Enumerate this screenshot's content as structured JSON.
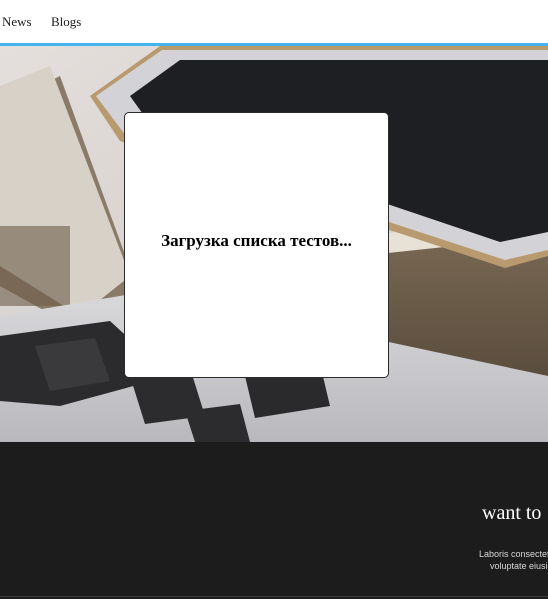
{
  "nav": {
    "items": [
      {
        "label": "News"
      },
      {
        "label": "Blogs"
      }
    ]
  },
  "modal": {
    "message": "Загрузка списка тестов..."
  },
  "promo": {
    "heading": "want to",
    "lines": [
      "Laboris consectet",
      "voluptate eiusi"
    ]
  },
  "colors": {
    "nav_border": "#46b4ec",
    "dark_section": "#1c1c1c",
    "modal_background": "#ffffff"
  }
}
